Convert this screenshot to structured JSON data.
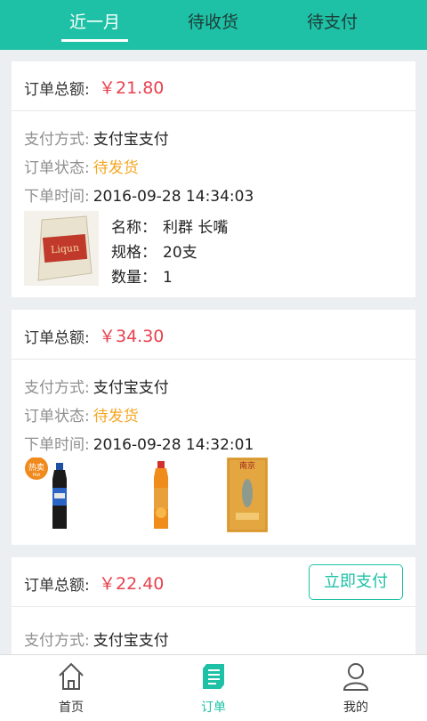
{
  "tabs": [
    {
      "label": "近一月",
      "active": true
    },
    {
      "label": "待收货",
      "active": false
    },
    {
      "label": "待支付",
      "active": false
    }
  ],
  "orders": [
    {
      "total_label": "订单总额:",
      "total": "￥21.80",
      "pay_method_label": "支付方式:",
      "pay_method": "支付宝支付",
      "status_label": "订单状态:",
      "status": "待发货",
      "time_label": "下单时间:",
      "time": "2016-09-28 14:34:03",
      "product": {
        "name_label": "名称：",
        "name": "利群 长嘴",
        "spec_label": "规格：",
        "spec": "20支",
        "qty_label": "数量：",
        "qty": "1",
        "pack_text": "利群 Liqun"
      }
    },
    {
      "total_label": "订单总额:",
      "total": "￥34.30",
      "pay_method_label": "支付方式:",
      "pay_method": "支付宝支付",
      "status_label": "订单状态:",
      "status": "待发货",
      "time_label": "下单时间:",
      "time": "2016-09-28 14:32:01",
      "hot_badge": "热卖",
      "hot_badge_sub": "Hot",
      "cig_pack_text": "南京"
    },
    {
      "total_label": "订单总额:",
      "total": "￥22.40",
      "pay_button": "立即支付",
      "pay_method_label": "支付方式:",
      "pay_method": "支付宝支付"
    }
  ],
  "bottom_nav": [
    {
      "label": "首页",
      "icon": "home-icon",
      "active": false
    },
    {
      "label": "订单",
      "icon": "order-icon",
      "active": true
    },
    {
      "label": "我的",
      "icon": "user-icon",
      "active": false
    }
  ],
  "colors": {
    "accent": "#1ec1a6",
    "price": "#e8414f",
    "status": "#f5a623"
  }
}
